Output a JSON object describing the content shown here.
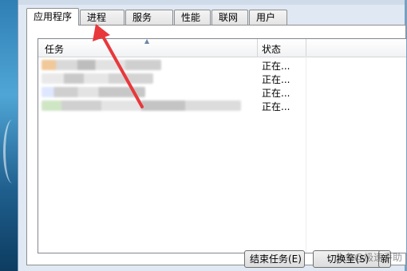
{
  "tabs": [
    {
      "label": "应用程序",
      "active": true
    },
    {
      "label": "进程",
      "active": false
    },
    {
      "label": "服务",
      "active": false
    },
    {
      "label": "性能",
      "active": false
    },
    {
      "label": "联网",
      "active": false
    },
    {
      "label": "用户",
      "active": false
    }
  ],
  "list": {
    "columns": {
      "task": "任务",
      "status": "状态"
    },
    "rows": [
      {
        "status": "正在..."
      },
      {
        "status": "正在..."
      },
      {
        "status": "正在..."
      },
      {
        "status": "正在..."
      }
    ]
  },
  "buttons": {
    "end_task": "结束任务(E)",
    "switch_to": "切换至(S)",
    "new_task": "新"
  },
  "watermark": "头条@极速手助",
  "colors": {
    "annotation_arrow": "#e8383c",
    "window_frame": "#dfe8f3",
    "desktop": "#2f7fb4"
  }
}
